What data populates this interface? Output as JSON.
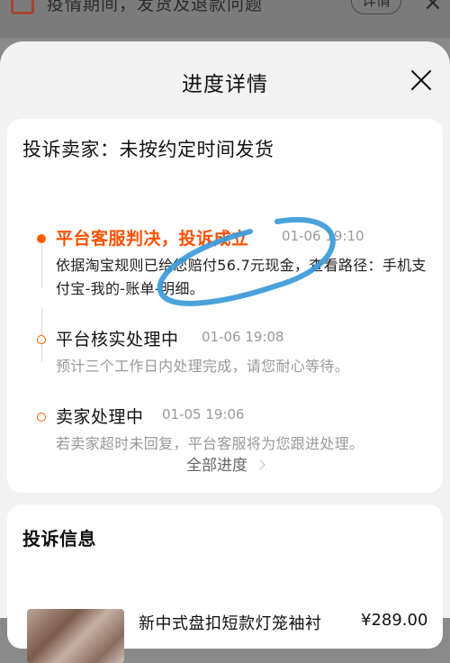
{
  "background_banner": {
    "text": "疫情期间，发货及退款问题",
    "button_label": "详情",
    "close_glyph": "×"
  },
  "sheet": {
    "title": "进度详情",
    "close_icon": "close-icon"
  },
  "progress_card": {
    "complaint_title": "投诉卖家：未按约定时间发货",
    "steps": [
      {
        "title": "平台客服判决，投诉成立",
        "time": "01-06 19:10",
        "desc": "依据淘宝规则已给您赔付56.7元现金，查看路径：手机支付宝-我的-账单-明细。",
        "active": true
      },
      {
        "title": "平台核实处理中",
        "time": "01-06 19:08",
        "desc": "预计三个工作日内处理完成，请您耐心等待。",
        "active": false
      },
      {
        "title": "卖家处理中",
        "time": "01-05 19:06",
        "desc": "若卖家超时未回复，平台客服将为您跟进处理。",
        "active": false
      }
    ],
    "all_progress_label": "全部进度"
  },
  "info_card": {
    "title": "投诉信息",
    "product_name": "新中式盘扣短款灯笼袖衬",
    "product_price": "¥289.00"
  },
  "colors": {
    "accent": "#ff5000",
    "annotation": "#3b9ad9",
    "muted": "#999999"
  }
}
